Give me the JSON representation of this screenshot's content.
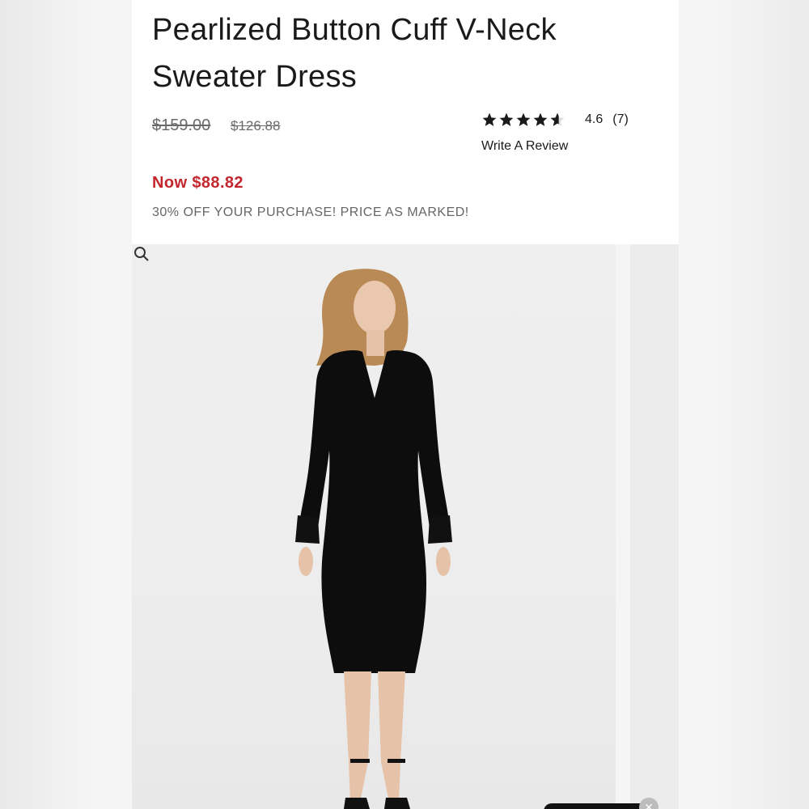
{
  "product": {
    "title": "Pearlized Button Cuff V-Neck Sweater Dress",
    "original_price": "$159.00",
    "previous_price": "$126.88",
    "now_price": "Now $88.82",
    "promo": "30% OFF YOUR PURCHASE! PRICE AS MARKED!"
  },
  "rating": {
    "value": "4.6",
    "count": "(7)",
    "stars": 4.6,
    "write_review_label": "Write A Review"
  },
  "colors": {
    "sale": "#c4262e",
    "text": "#1a1a1a",
    "muted": "#666666"
  },
  "icons": {
    "zoom": "zoom-icon",
    "close": "close-icon",
    "star": "star-icon"
  }
}
